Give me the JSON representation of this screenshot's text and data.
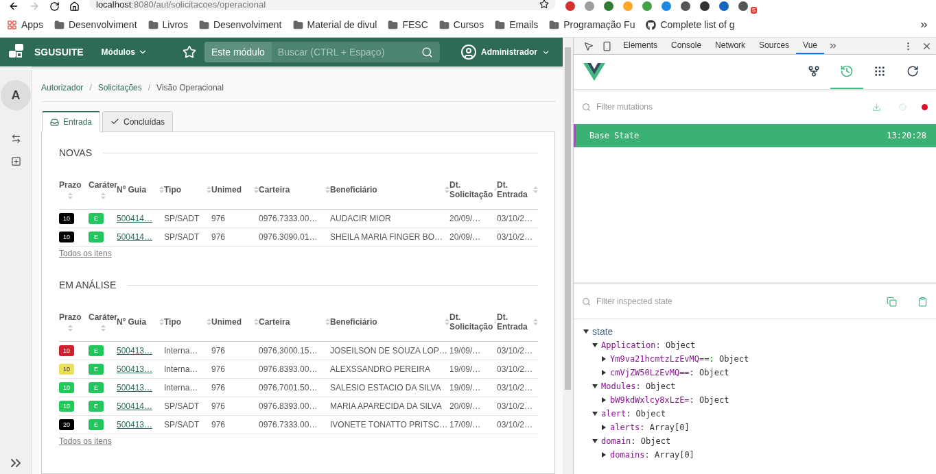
{
  "browser": {
    "url_host": "localhost",
    "url_path": ":8080/aut/solicitacoes/operacional",
    "extension_badge": "5"
  },
  "bookmarks": [
    {
      "kind": "apps",
      "label": "Apps"
    },
    {
      "kind": "folder",
      "label": "Desenvolviment"
    },
    {
      "kind": "folder",
      "label": "Livros"
    },
    {
      "kind": "folder",
      "label": "Desenvolviment"
    },
    {
      "kind": "folder",
      "label": "Material de divul"
    },
    {
      "kind": "folder",
      "label": "FESC"
    },
    {
      "kind": "folder",
      "label": "Cursos"
    },
    {
      "kind": "folder",
      "label": "Emails"
    },
    {
      "kind": "folder",
      "label": "Programação Fu"
    },
    {
      "kind": "github",
      "label": "Complete list of g"
    }
  ],
  "header": {
    "brand": "SGUSUITE",
    "modules": "Módulos",
    "scope": "Este módulo",
    "search_placeholder": "Buscar (CTRL + Espaço)",
    "user": "Administrador"
  },
  "sidebar": {
    "avatar": "A"
  },
  "breadcrumb": [
    {
      "label": "Autorizador"
    },
    {
      "separator": "/",
      "label": "Solicitações"
    },
    {
      "separator": "/",
      "label": "Visão Operacional"
    }
  ],
  "tabs": [
    {
      "label": "Entrada",
      "selected": true
    },
    {
      "label": "Concluídas",
      "selected": false
    }
  ],
  "sections": [
    {
      "title": "NOVAS",
      "footer_link": "Todos os itens",
      "columns": [
        "Prazo",
        "Caráter",
        "Nº Guia",
        "Tipo",
        "Unimed",
        "Carteira",
        "Beneficiário",
        "Dt. Solicitação",
        "Dt. Entrada"
      ],
      "rows": [
        {
          "prazo": "10",
          "color": "#000000",
          "carater": "E",
          "guia": "500414…",
          "tipo": "SP/SADT",
          "unimed": "976",
          "carteira": "0976.7333.00…",
          "beneficiario": "AUDACIR MIOR",
          "dt_solicitacao": "20/09/…",
          "dt_entrada": "03/10/2…"
        },
        {
          "prazo": "10",
          "color": "#000000",
          "carater": "E",
          "guia": "500414…",
          "tipo": "SP/SADT",
          "unimed": "976",
          "carteira": "0976.3090.01…",
          "beneficiario": "SHEILA MARIA FINGER BO…",
          "dt_solicitacao": "20/09/…",
          "dt_entrada": "03/10/2…"
        }
      ]
    },
    {
      "title": "EM ANÁLISE",
      "footer_link": "Todos os itens",
      "columns": [
        "Prazo",
        "Caráter",
        "Nº Guia",
        "Tipo",
        "Unimed",
        "Carteira",
        "Beneficiário",
        "Dt. Solicitação",
        "Dt. Entrada"
      ],
      "rows": [
        {
          "prazo": "10",
          "color": "#d01f2f",
          "carater": "E",
          "guia": "500413…",
          "tipo": "Interna…",
          "unimed": "976",
          "carteira": "0976.3000.15…",
          "beneficiario": "JOSEILSON DE SOUZA LOP…",
          "dt_solicitacao": "19/09/…",
          "dt_entrada": "03/10/2…"
        },
        {
          "prazo": "10",
          "color": "#ebe05a",
          "carater": "E",
          "guia": "500413…",
          "tipo": "Interna…",
          "unimed": "976",
          "carteira": "0976.8393.00…",
          "beneficiario": "ALEXSSANDRO PEREIRA",
          "dt_solicitacao": "19/09/…",
          "dt_entrada": "03/10/2…"
        },
        {
          "prazo": "10",
          "color": "#1fcc5a",
          "carater": "E",
          "guia": "500413…",
          "tipo": "Interna…",
          "unimed": "976",
          "carteira": "0976.7001.50…",
          "beneficiario": "SALESIO ESTACIO DA SILVA",
          "dt_solicitacao": "19/09/…",
          "dt_entrada": "03/10/2…"
        },
        {
          "prazo": "10",
          "color": "#1fcc5a",
          "carater": "E",
          "guia": "500414…",
          "tipo": "SP/SADT",
          "unimed": "976",
          "carteira": "0976.8393.00…",
          "beneficiario": "MARIA APARECIDA DA SILVA",
          "dt_solicitacao": "20/09/…",
          "dt_entrada": "03/10/2…"
        },
        {
          "prazo": "20",
          "color": "#000000",
          "carater": "E",
          "guia": "500413…",
          "tipo": "SP/SADT",
          "unimed": "976",
          "carteira": "0976.7333.00…",
          "beneficiario": "IVONETE TONATTO PRITSC…",
          "dt_solicitacao": "17/09/…",
          "dt_entrada": "03/10/2…"
        }
      ]
    }
  ],
  "devtools": {
    "tabs": [
      {
        "label": "Elements",
        "selected": false
      },
      {
        "label": "Console",
        "selected": false
      },
      {
        "label": "Network",
        "selected": false
      },
      {
        "label": "Sources",
        "selected": false
      },
      {
        "label": "Vue",
        "selected": true
      }
    ],
    "vue_toolbar": [
      {
        "kind": "components",
        "selected": false
      },
      {
        "kind": "vuex",
        "selected": true
      },
      {
        "kind": "events",
        "selected": false
      },
      {
        "kind": "refresh",
        "selected": false
      }
    ],
    "mutation_filter_placeholder": "Filter mutations",
    "mutations": [
      {
        "name": "Base State",
        "time": "13:20:28",
        "selected": true
      }
    ],
    "state_filter_placeholder": "Filter inspected state",
    "state_root": "state",
    "tree": [
      {
        "key": "Application",
        "value": ": Object",
        "expanded": true,
        "children": [
          {
            "key": "Ym9va21hcmtzLzEvMQ==",
            "value": ": Object",
            "expanded": false
          },
          {
            "key": "cmVjZW50LzEvMQ==",
            "value": ": Object",
            "expanded": false
          }
        ]
      },
      {
        "key": "Modules",
        "value": ": Object",
        "expanded": true,
        "children": [
          {
            "key": "bW9kdWxlcy8xLzE=",
            "value": ": Object",
            "expanded": false
          }
        ]
      },
      {
        "key": "alert",
        "value": ": Object",
        "expanded": true,
        "children": [
          {
            "key": "alerts",
            "value": ": Array[0]",
            "expanded": false
          }
        ]
      },
      {
        "key": "domain",
        "value": ": Object",
        "expanded": true,
        "children": [
          {
            "key": "domains",
            "value": ": Array[0]",
            "expanded": false
          }
        ]
      }
    ]
  }
}
